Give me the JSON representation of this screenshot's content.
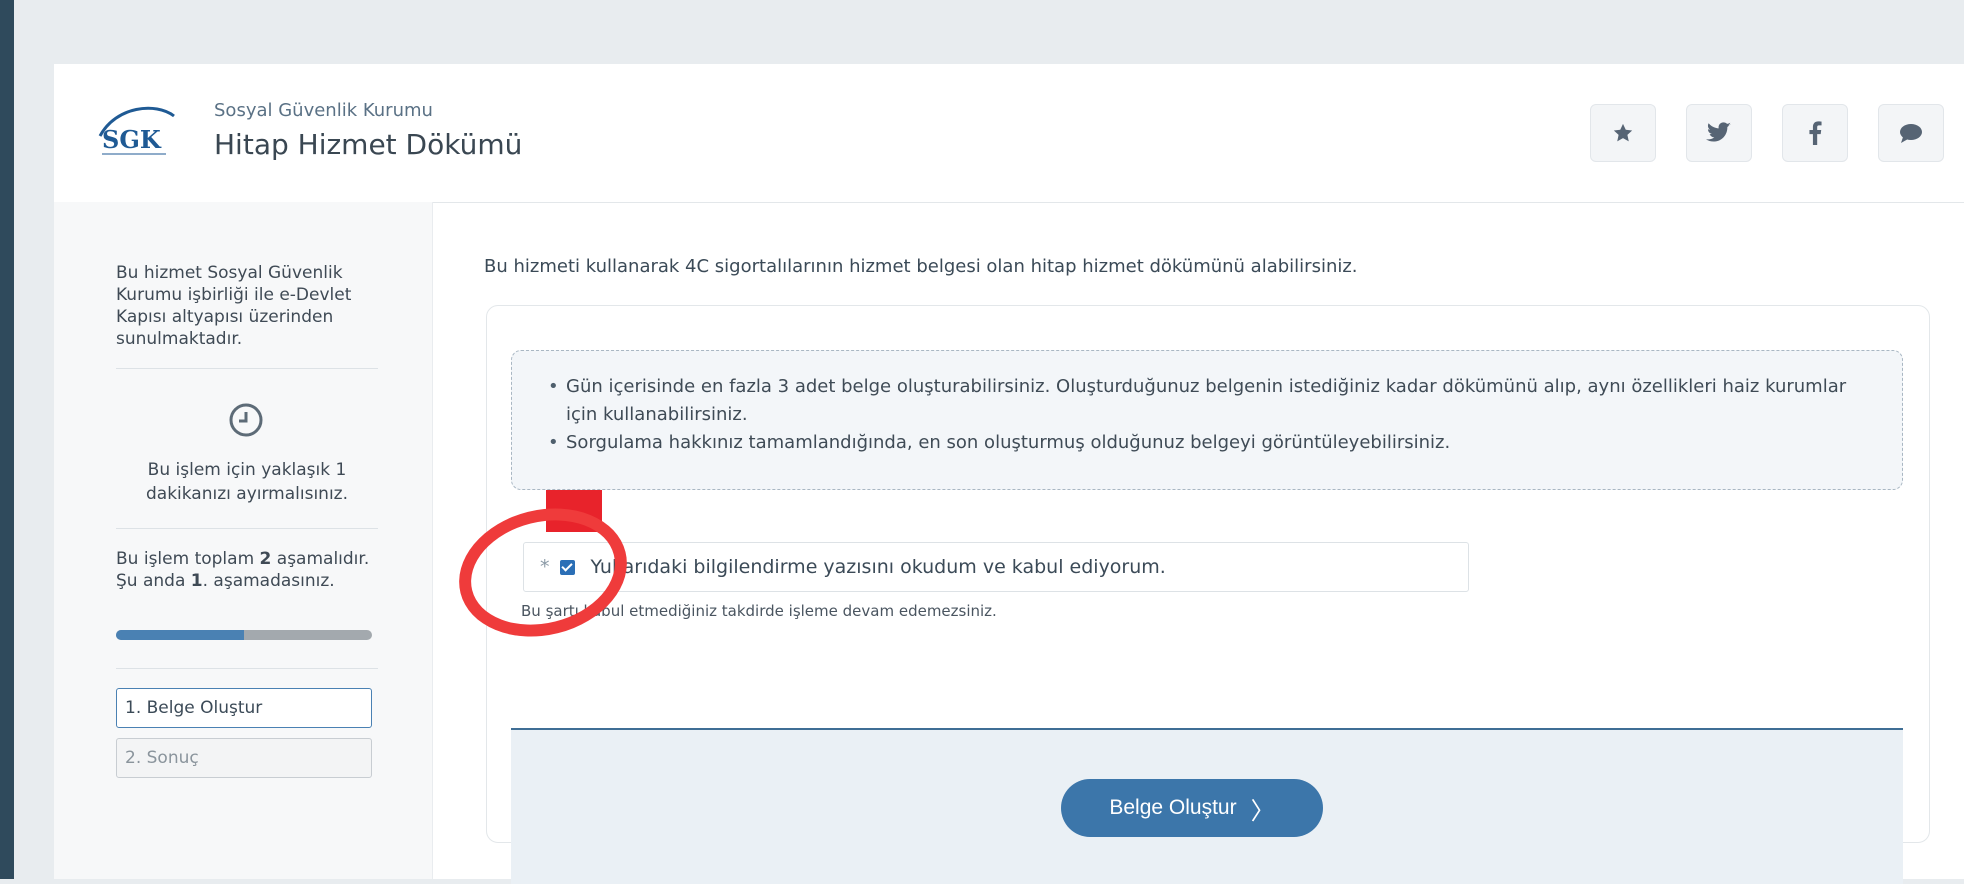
{
  "header": {
    "org_name": "Sosyal Güvenlik Kurumu",
    "service_title": "Hitap Hizmet Dökümü",
    "logo_text": "SGK",
    "share_icons": [
      "star-icon",
      "twitter-icon",
      "facebook-icon",
      "comment-icon"
    ]
  },
  "sidebar": {
    "info_text": "Bu hizmet Sosyal Güvenlik Kurumu işbirliği ile e-Devlet Kapısı altyapısı üzerinden sunulmaktadır.",
    "time_text": "Bu işlem için yaklaşık 1 dakikanızı ayırmalısınız.",
    "steps": {
      "pre": "Bu işlem toplam ",
      "total": "2",
      "mid": " aşamalıdır. Şu anda ",
      "current": "1",
      "post": ". aşamadasınız."
    },
    "progress_fraction": 0.5,
    "step_items": [
      "1. Belge Oluştur",
      "2. Sonuç"
    ]
  },
  "main": {
    "intro": "Bu hizmeti kullanarak 4C sigortalılarının hizmet belgesi olan hitap hizmet dökümünü alabilirsiniz.",
    "notices": [
      "Gün içerisinde en fazla 3 adet belge oluşturabilirsiniz. Oluşturduğunuz belgenin istediğiniz kadar dökümünü alıp, aynı özellikleri haiz kurumlar için kullanabilirsiniz.",
      "Sorgulama hakkınız tamamlandığında, en son oluşturmuş olduğunuz belgeyi görüntüleyebilirsiniz."
    ],
    "consent": {
      "asterisk": "*",
      "checked": true,
      "label": "Yukarıdaki bilgilendirme yazısını okudum ve kabul ediyorum."
    },
    "hint": "Bu şartı kabul etmediğiniz takdirde işleme devam edemezsiniz.",
    "submit_label": "Belge Oluştur",
    "submit_chevron": "〉"
  },
  "colors": {
    "accent": "#3c76aa",
    "annotation": "#ef3b3b"
  }
}
